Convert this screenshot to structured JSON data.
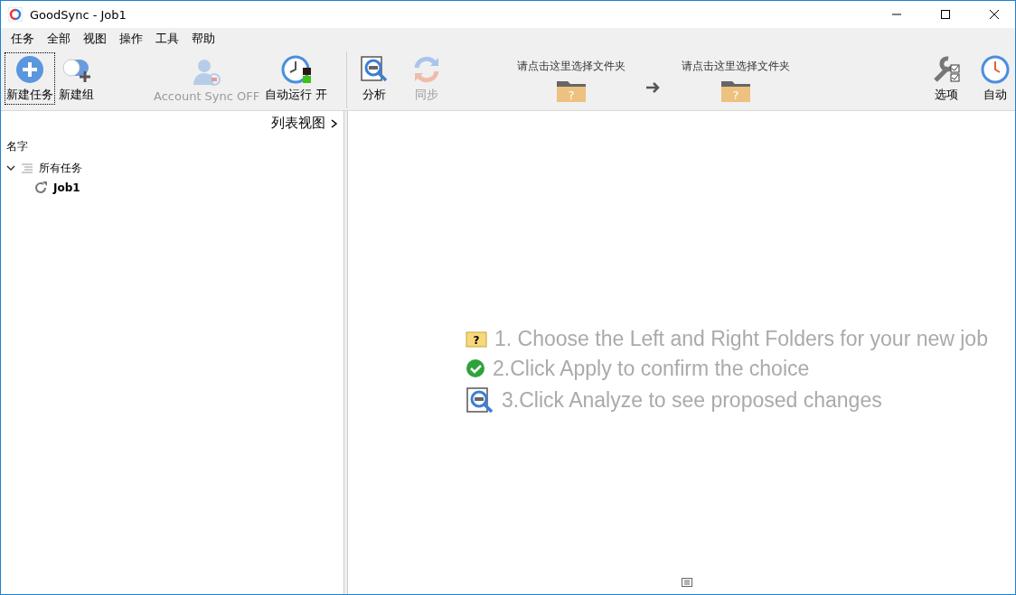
{
  "window": {
    "title": "GoodSync - Job1"
  },
  "menu": [
    "任务",
    "全部",
    "视图",
    "操作",
    "工具",
    "帮助"
  ],
  "toolbar_left": [
    {
      "label": "新建任务",
      "kind": "plus",
      "disabled": false,
      "focused": true
    },
    {
      "label": "新建组",
      "kind": "group",
      "disabled": false,
      "focused": false
    },
    {
      "label": "Account Sync OFF",
      "kind": "account",
      "disabled": true,
      "focused": false
    },
    {
      "label": "自动运行 开",
      "kind": "autorun",
      "disabled": false,
      "focused": false
    }
  ],
  "toolbar_job": [
    {
      "label": "分析",
      "kind": "analyze",
      "disabled": false
    },
    {
      "label": "同步",
      "kind": "sync",
      "disabled": true
    }
  ],
  "folders": [
    {
      "label": "请点击这里选择文件夹",
      "mark": "?"
    },
    {
      "label": "请点击这里选择文件夹",
      "mark": "?"
    }
  ],
  "toolbar_right": [
    {
      "label": "选项",
      "kind": "options",
      "disabled": false
    },
    {
      "label": "自动",
      "kind": "clock",
      "disabled": false
    }
  ],
  "list_view": "列表视图",
  "column": "名字",
  "tree": [
    {
      "label": "所有任务",
      "expanded": true,
      "children": [
        {
          "label": "Job1"
        }
      ]
    }
  ],
  "steps": [
    {
      "text": "1. Choose the Left and Right Folders for your new job",
      "kind": "folder",
      "mark": "?"
    },
    {
      "text": "2.Click Apply to confirm the choice",
      "kind": "check"
    },
    {
      "text": "3.Click Analyze to see proposed changes",
      "kind": "analyze"
    }
  ]
}
